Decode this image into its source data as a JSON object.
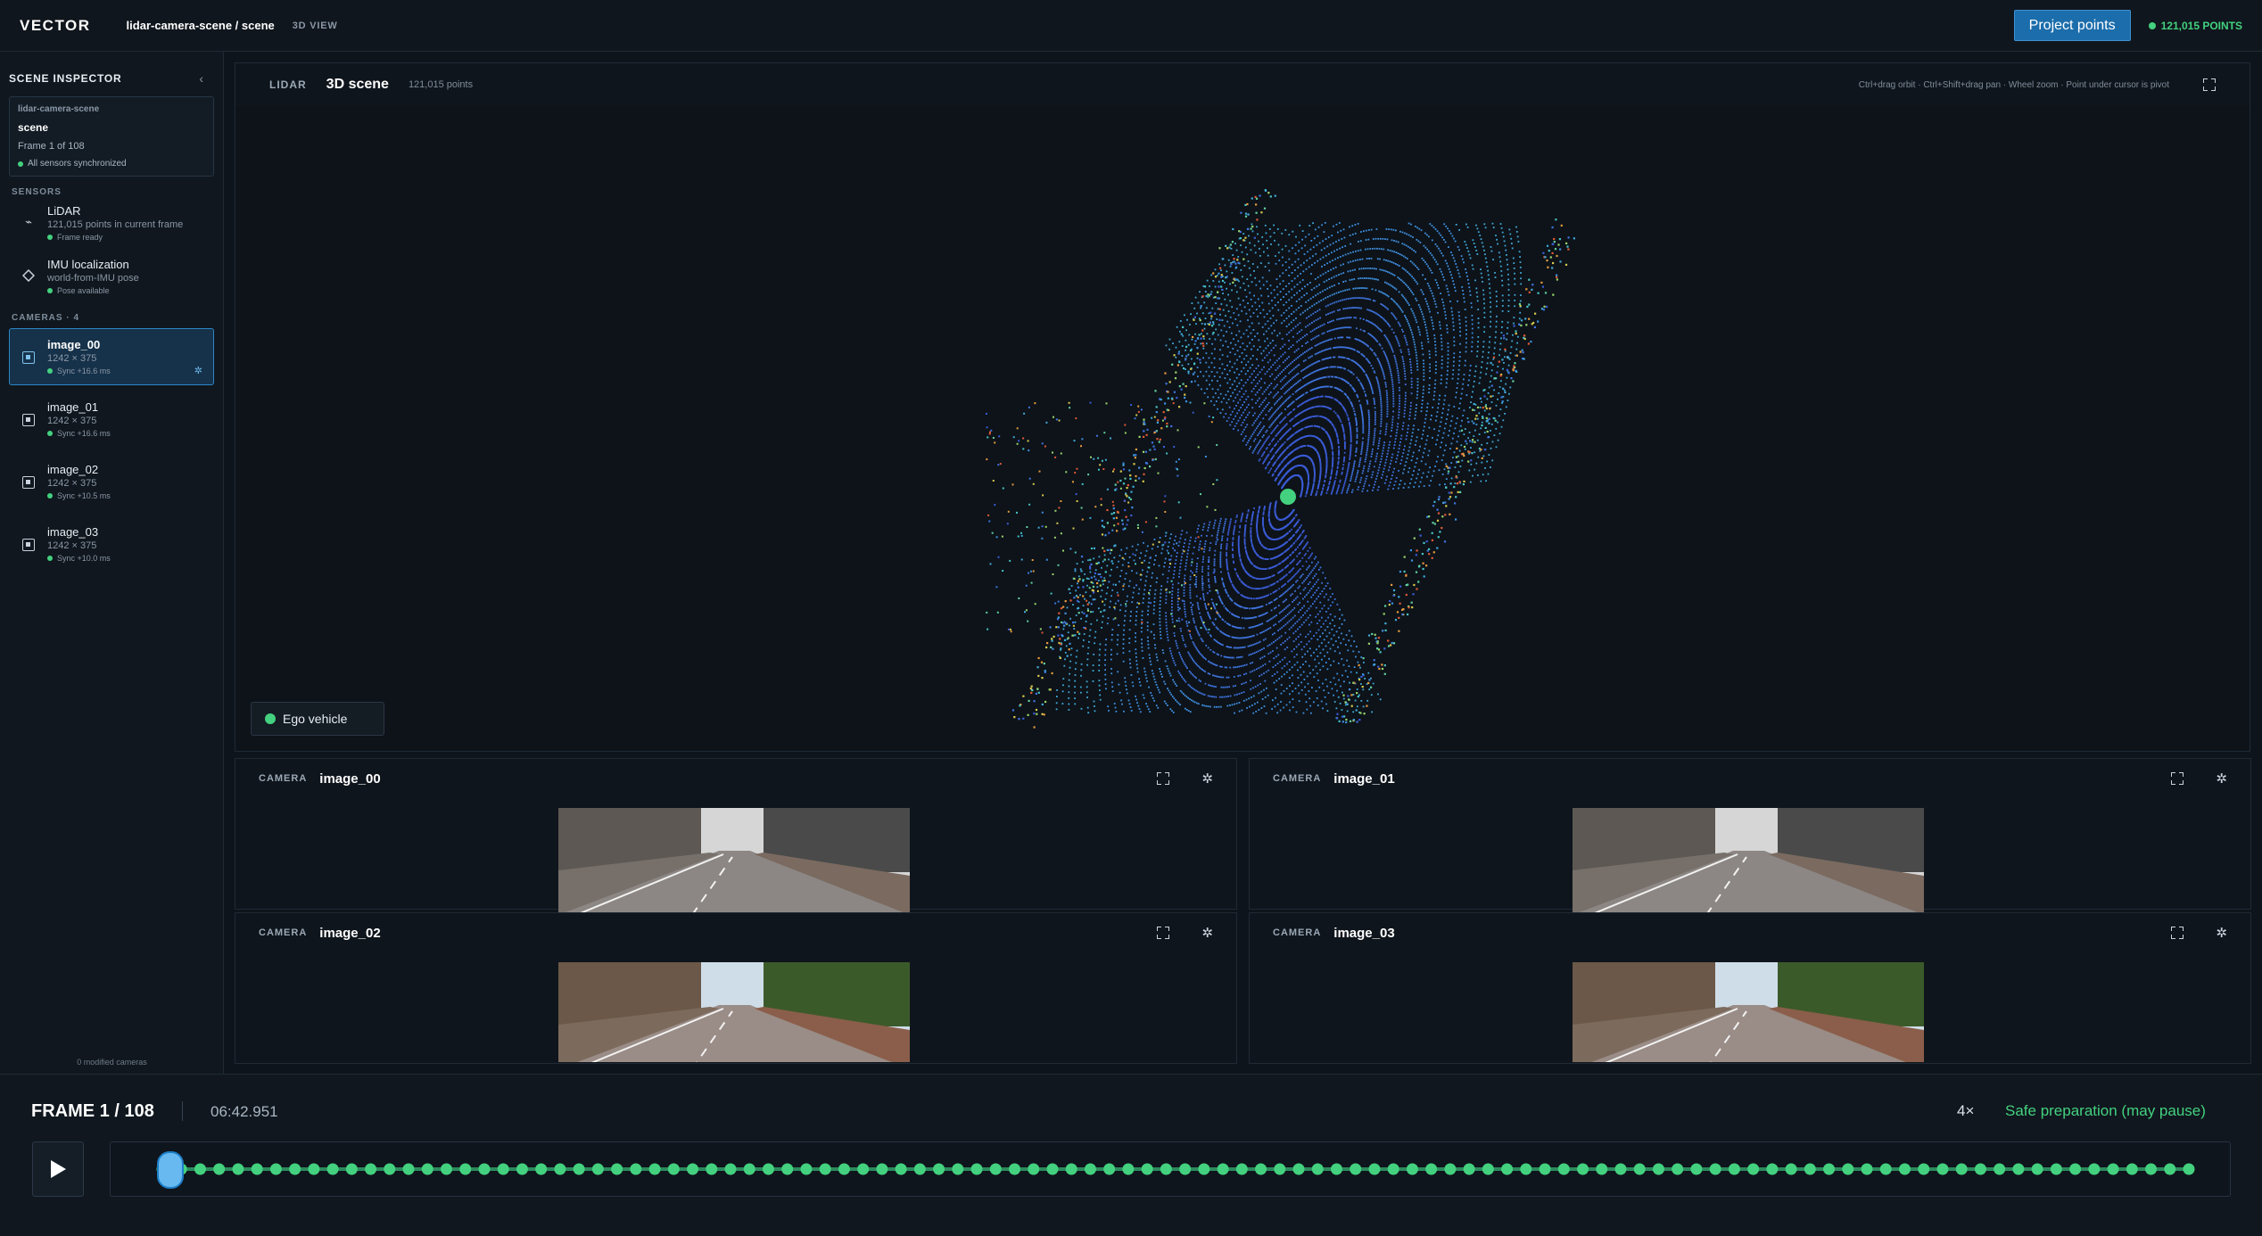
{
  "header": {
    "brand": "VECTOR",
    "breadcrumb": "lidar-camera-scene / scene",
    "view_tag": "3D VIEW",
    "project_button": "Project points",
    "points_badge": "121,015 POINTS"
  },
  "sidebar": {
    "title": "SCENE INSPECTOR",
    "scene_card": {
      "dataset": "lidar-camera-scene",
      "scene": "scene",
      "frame": "Frame 1 of 108",
      "sync": "All sensors synchronized"
    },
    "sensors_label": "SENSORS",
    "sensors": [
      {
        "name": "LiDAR",
        "sub": "121,015 points in current frame",
        "status": "Frame ready",
        "icon": "lidar-icon"
      },
      {
        "name": "IMU localization",
        "sub": "world-from-IMU pose",
        "status": "Pose available",
        "icon": "diamond-icon"
      }
    ],
    "cameras_label": "CAMERAS · 4",
    "cameras": [
      {
        "name": "image_00",
        "res": "1242 × 375",
        "sync": "Sync +16.6 ms",
        "active": true
      },
      {
        "name": "image_01",
        "res": "1242 × 375",
        "sync": "Sync +16.6 ms",
        "active": false
      },
      {
        "name": "image_02",
        "res": "1242 × 375",
        "sync": "Sync +10.5 ms",
        "active": false
      },
      {
        "name": "image_03",
        "res": "1242 × 375",
        "sync": "Sync +10.0 ms",
        "active": false
      }
    ],
    "footer": "0 modified cameras"
  },
  "scene_view": {
    "tag": "LIDAR",
    "title": "3D scene",
    "points": "121,015 points",
    "hint": "Ctrl+drag orbit · Ctrl+Shift+drag pan · Wheel zoom · Point under cursor is pivot",
    "ego_label": "Ego vehicle"
  },
  "camera_panels": [
    {
      "tag": "CAMERA",
      "title": "image_00"
    },
    {
      "tag": "CAMERA",
      "title": "image_01"
    },
    {
      "tag": "CAMERA",
      "title": "image_02"
    },
    {
      "tag": "CAMERA",
      "title": "image_03"
    }
  ],
  "playback": {
    "frame": "FRAME 1 / 108",
    "timecode": "06:42.951",
    "speed": "4×",
    "mode": "Safe preparation (may pause)",
    "total_frames": 108,
    "current_frame": 1
  },
  "colors": {
    "accent": "#1b6dab",
    "status_green": "#43d17f",
    "active_border": "#2c87c7"
  }
}
